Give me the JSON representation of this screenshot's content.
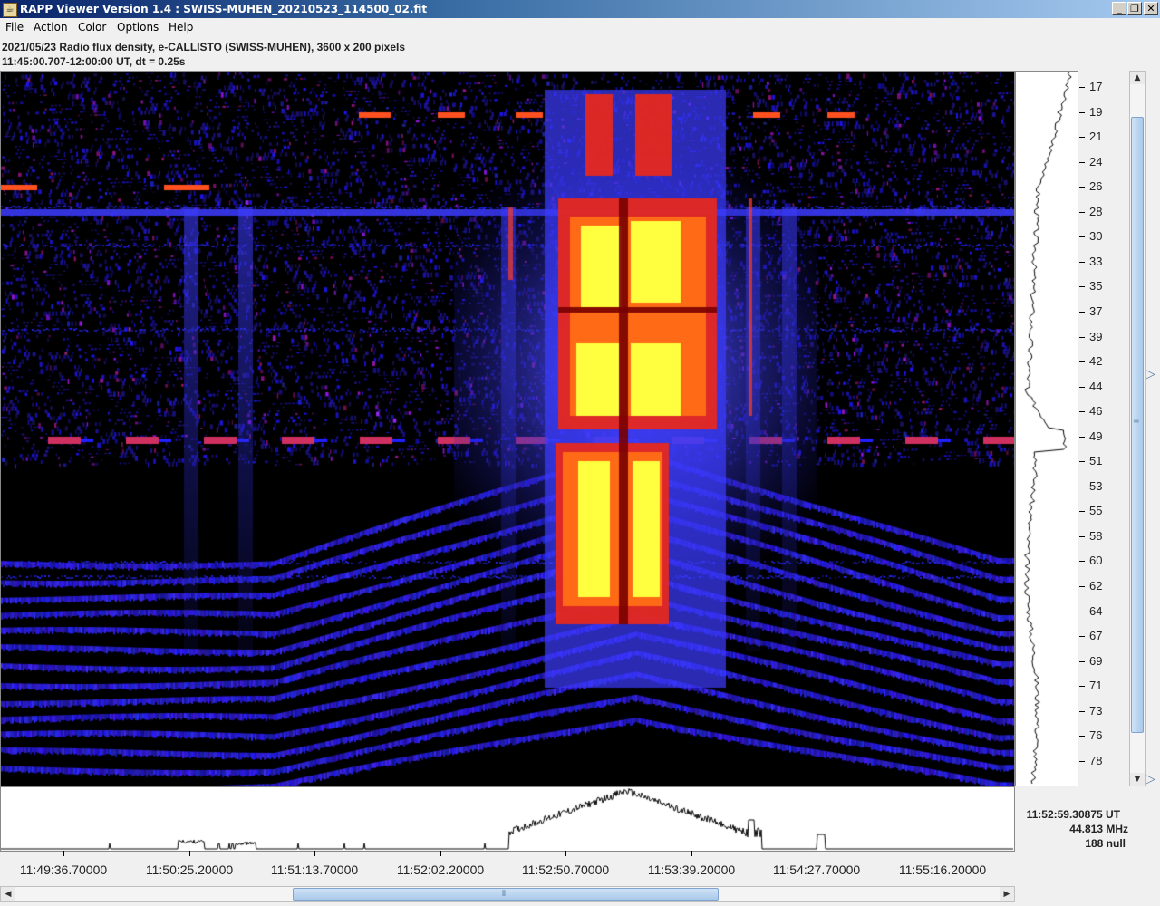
{
  "window": {
    "title": "RAPP Viewer Version 1.4 : SWISS-MUHEN_20210523_114500_02.fit",
    "minimize_label": "_",
    "restore_label": "❐",
    "close_label": "✕"
  },
  "menu": [
    "File",
    "Action",
    "Color",
    "Options",
    "Help"
  ],
  "info": {
    "line1": "2021/05/23  Radio flux density, e-CALLISTO (SWISS-MUHEN),  3600 x 200 pixels",
    "line2": "11:45:00.707-12:00:00 UT,  dt = 0.25s"
  },
  "frequency_axis": {
    "labels": [
      "17",
      "19",
      "21",
      "24",
      "26",
      "28",
      "30",
      "33",
      "35",
      "37",
      "39",
      "42",
      "44",
      "46",
      "49",
      "51",
      "53",
      "55",
      "58",
      "60",
      "62",
      "64",
      "67",
      "69",
      "71",
      "73",
      "76",
      "78"
    ]
  },
  "time_axis": {
    "labels": [
      "11:49:36.70000",
      "11:50:25.20000",
      "11:51:13.70000",
      "11:52:02.20000",
      "11:52:50.70000",
      "11:53:39.20000",
      "11:54:27.70000",
      "11:55:16.20000"
    ]
  },
  "readout": {
    "time": "11:52:59.30875 UT",
    "frequency": "44.813 MHz",
    "value": "188 null"
  },
  "colors": {
    "burst_core": "#ffff40",
    "burst_mid": "#ff3000",
    "background_emission": "#2020ff",
    "titlebar": "#0a246a"
  }
}
